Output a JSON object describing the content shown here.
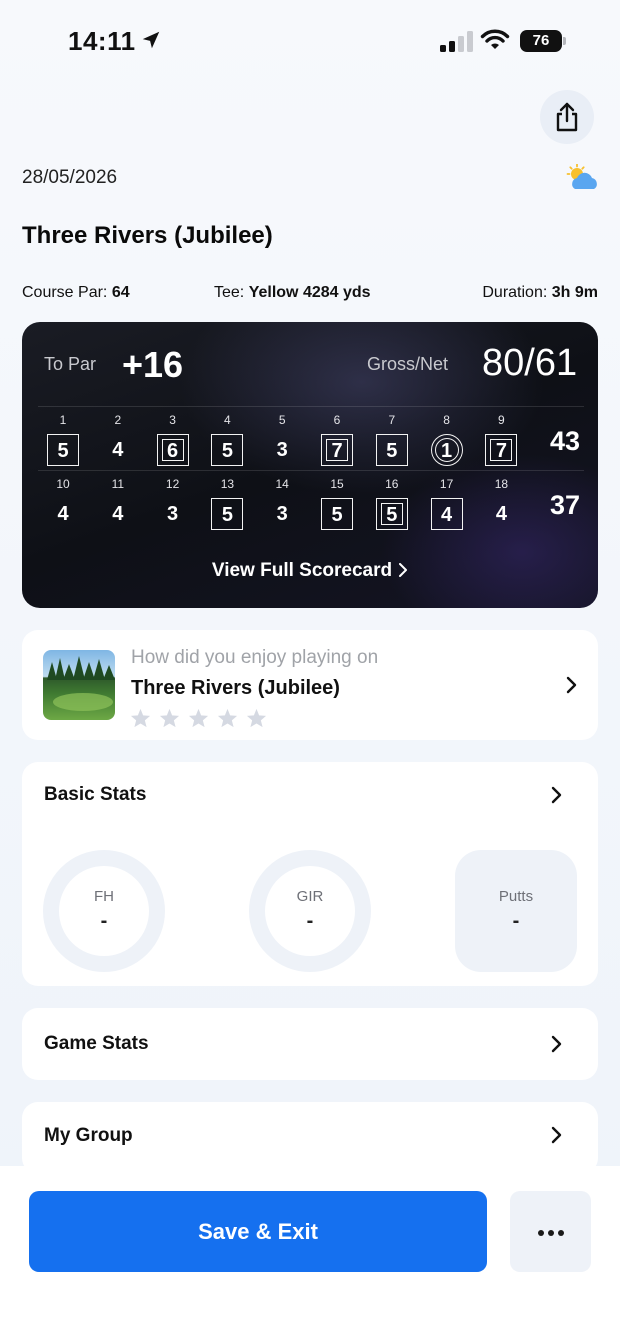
{
  "status_bar": {
    "time": "14:11",
    "battery": "76",
    "signal_bars": 2
  },
  "header": {
    "date": "28/05/2026",
    "weather_icon": "partly-cloudy-icon",
    "share_icon": "share-icon"
  },
  "course": {
    "title": "Three Rivers (Jubilee)",
    "par_label": "Course Par:",
    "par_value": "64",
    "tee_label": "Tee:",
    "tee_value": "Yellow 4284 yds",
    "duration_label": "Duration:",
    "duration_value": "3h 9m"
  },
  "scorecard": {
    "to_par_label": "To Par",
    "to_par_value": "+16",
    "gross_net_label": "Gross/Net",
    "gross_net_value": "80/61",
    "front_nine": [
      {
        "hole": "1",
        "score": "5",
        "style": "bogey"
      },
      {
        "hole": "2",
        "score": "4",
        "style": "par"
      },
      {
        "hole": "3",
        "score": "6",
        "style": "double"
      },
      {
        "hole": "4",
        "score": "5",
        "style": "bogey"
      },
      {
        "hole": "5",
        "score": "3",
        "style": "par"
      },
      {
        "hole": "6",
        "score": "7",
        "style": "double"
      },
      {
        "hole": "7",
        "score": "5",
        "style": "bogey"
      },
      {
        "hole": "8",
        "score": "1",
        "style": "birdie"
      },
      {
        "hole": "9",
        "score": "7",
        "style": "double"
      }
    ],
    "back_nine": [
      {
        "hole": "10",
        "score": "4",
        "style": "par"
      },
      {
        "hole": "11",
        "score": "4",
        "style": "par"
      },
      {
        "hole": "12",
        "score": "3",
        "style": "par"
      },
      {
        "hole": "13",
        "score": "5",
        "style": "bogey"
      },
      {
        "hole": "14",
        "score": "3",
        "style": "par"
      },
      {
        "hole": "15",
        "score": "5",
        "style": "bogey"
      },
      {
        "hole": "16",
        "score": "5",
        "style": "double"
      },
      {
        "hole": "17",
        "score": "4",
        "style": "bogey"
      },
      {
        "hole": "18",
        "score": "4",
        "style": "par"
      }
    ],
    "front_total": "43",
    "back_total": "37",
    "view_link": "View Full Scorecard"
  },
  "rating": {
    "question": "How did you enjoy playing on",
    "course": "Three Rivers (Jubilee)",
    "stars": 0,
    "max_stars": 5
  },
  "basic_stats": {
    "title": "Basic Stats",
    "items": [
      {
        "label": "FH",
        "value": "-"
      },
      {
        "label": "GIR",
        "value": "-"
      },
      {
        "label": "Putts",
        "value": "-"
      }
    ]
  },
  "game_stats": {
    "title": "Game Stats"
  },
  "my_group": {
    "title": "My Group"
  },
  "footer": {
    "save_label": "Save & Exit",
    "more_icon": "more-icon"
  },
  "colors": {
    "primary": "#1570ef",
    "card_dark": "#12141c",
    "star_empty": "#d5d9e2"
  }
}
